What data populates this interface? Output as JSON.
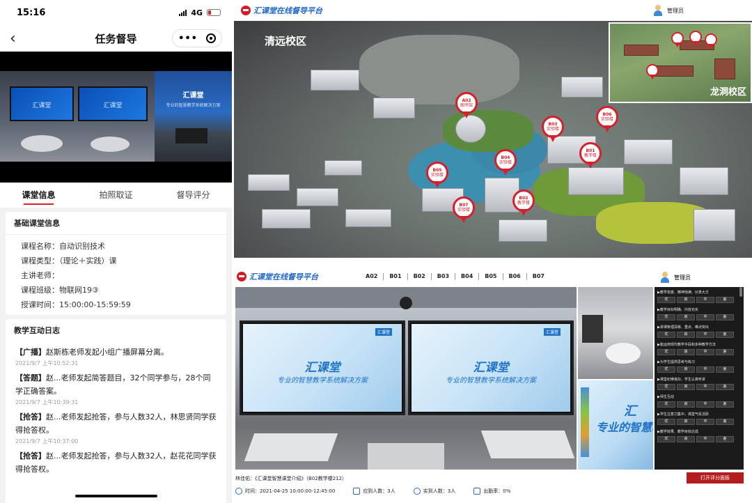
{
  "phone": {
    "status": {
      "time": "15:16",
      "network": "4G"
    },
    "nav": {
      "title": "任务督导",
      "back_icon": "‹",
      "more": "•••"
    },
    "video": {
      "main_screen_text": "汇课堂",
      "side_title": "汇课堂",
      "side_subtitle": "专业的智慧教学系统解决方案"
    },
    "tabs": [
      {
        "label": "课堂信息",
        "active": true
      },
      {
        "label": "拍照取证",
        "active": false
      },
      {
        "label": "督导评分",
        "active": false
      }
    ],
    "basic_info": {
      "title": "基础课堂信息",
      "rows": [
        "课程名称：自动识别技术",
        "课程类型：（理论＋实践）课",
        "主讲老师：",
        "课程班级：物联网19③",
        "授课时间：15:00:00-15:59:59"
      ]
    },
    "interaction_log": {
      "title": "教学互动日志",
      "items": [
        {
          "tag": "【广播】",
          "text": "赵斯栋老师发起小组广播屏幕分离。",
          "time": "2021/9/7 上午10:52:31"
        },
        {
          "tag": "【答题】",
          "text": "赵...老师发起简答题目，32个同学参与，28个同学正确答案。",
          "time": "2021/9/7 上午10:39:31"
        },
        {
          "tag": "【抢答】",
          "text": "赵...老师发起抢答，参与人数32人，林思贤同学获得抢答权。",
          "time": "2021/9/7 上午10:37:00"
        },
        {
          "tag": "【抢答】",
          "text": "赵...老师发起抢答，参与人数32人，赵花花同学获得抢答权。",
          "time": ""
        }
      ]
    }
  },
  "map": {
    "brand": "汇课堂在线督导平台",
    "user": "管理员",
    "campus_main": "清远校区",
    "campus_inset": "龙洞校区",
    "pins": [
      {
        "code": "A02",
        "name": "图书馆"
      },
      {
        "code": "B03",
        "name": "实验楼"
      },
      {
        "code": "B06",
        "name": "实验楼"
      },
      {
        "code": "B01",
        "name": "教学楼"
      },
      {
        "code": "B04",
        "name": "实验楼"
      },
      {
        "code": "B05",
        "name": "实验楼"
      },
      {
        "code": "B02",
        "name": "教学楼"
      },
      {
        "code": "B07",
        "name": "实验楼"
      }
    ],
    "inset_pins": [
      "",
      "",
      "",
      ""
    ]
  },
  "room": {
    "brand": "汇课堂在线督导平台",
    "user": "管理员",
    "building_tabs": [
      "A02",
      "B01",
      "B02",
      "B03",
      "B04",
      "B05",
      "B06",
      "B07"
    ],
    "screens": {
      "title": "汇课堂",
      "subtitle": "专业的智慧教学系统解决方案",
      "logo": "汇课堂"
    },
    "side_screen_text": "专业的智慧教",
    "side_screen_title": "汇",
    "evaluation": [
      {
        "question": "▶教学态度、精神饱满、仪表大方",
        "options": [
          "优",
          "良",
          "中",
          "差"
        ]
      },
      {
        "question": "▶教学目标明确、内容充实",
        "options": [
          "优",
          "良",
          "中",
          "差"
        ]
      },
      {
        "question": "▶讲课条理清晰、重点、难点突出",
        "options": [
          "优",
          "良",
          "中",
          "差"
        ]
      },
      {
        "question": "▶能运用现代教学手段和多种教学方法",
        "options": [
          "优",
          "良",
          "中",
          "差"
        ]
      },
      {
        "question": "▶为学生提供思考与练习",
        "options": [
          "优",
          "良",
          "中",
          "差"
        ]
      },
      {
        "question": "▶课堂纪律良好，学生认真听讲",
        "options": [
          "优",
          "良",
          "中",
          "差"
        ]
      },
      {
        "question": "▶师生互动",
        "options": [
          "优",
          "良",
          "中",
          "差"
        ]
      },
      {
        "question": "▶学生注意力集中，课堂气氛活跃",
        "options": [
          "优",
          "良",
          "中",
          "差"
        ]
      },
      {
        "question": "▶教学效果、教学目标达成",
        "options": [
          "优",
          "良",
          "中",
          "差"
        ]
      }
    ],
    "footer": {
      "course": "林佳佑：《汇课堂智慧课堂介绍》（B02教学楼212）",
      "time": "时间：2021-04-25 10:00:00-12:45:00",
      "expected": "应到人数：3人",
      "actual": "实到人数：3人",
      "attendance": "出勤率：0%",
      "open_eval_label": "打开评分面板"
    },
    "colors": {
      "accent": "#b31d1d",
      "brand_blue": "#1e66c8"
    }
  }
}
